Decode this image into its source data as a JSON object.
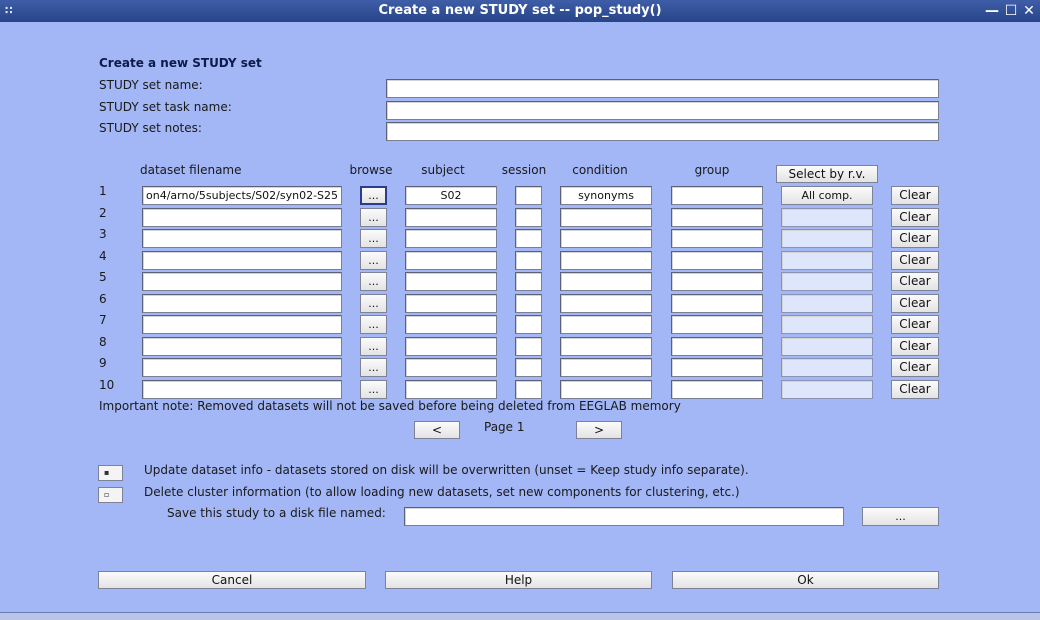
{
  "window": {
    "title": "Create a new STUDY set -- pop_study()",
    "minimize": "—",
    "maximize": "☐",
    "close": "✕"
  },
  "form": {
    "heading": "Create a new STUDY set",
    "name_label": "STUDY set name:",
    "task_label": "STUDY set task name:",
    "notes_label": "STUDY set notes:",
    "name_value": "",
    "task_value": "",
    "notes_value": ""
  },
  "table": {
    "headers": {
      "filename": "dataset filename",
      "browse": "browse",
      "subject": "subject",
      "session": "session",
      "condition": "condition",
      "group": "group"
    },
    "select_rv_label": "Select by r.v.",
    "browse_label": "...",
    "clear_label": "Clear",
    "rows": [
      {
        "num": "1",
        "filename": "on4/arno/5subjects/S02/syn02-S25",
        "subject": "S02",
        "session": "",
        "condition": "synonyms",
        "group": "",
        "comp": "All comp."
      },
      {
        "num": "2",
        "filename": "",
        "subject": "",
        "session": "",
        "condition": "",
        "group": "",
        "comp": ""
      },
      {
        "num": "3",
        "filename": "",
        "subject": "",
        "session": "",
        "condition": "",
        "group": "",
        "comp": ""
      },
      {
        "num": "4",
        "filename": "",
        "subject": "",
        "session": "",
        "condition": "",
        "group": "",
        "comp": ""
      },
      {
        "num": "5",
        "filename": "",
        "subject": "",
        "session": "",
        "condition": "",
        "group": "",
        "comp": ""
      },
      {
        "num": "6",
        "filename": "",
        "subject": "",
        "session": "",
        "condition": "",
        "group": "",
        "comp": ""
      },
      {
        "num": "7",
        "filename": "",
        "subject": "",
        "session": "",
        "condition": "",
        "group": "",
        "comp": ""
      },
      {
        "num": "8",
        "filename": "",
        "subject": "",
        "session": "",
        "condition": "",
        "group": "",
        "comp": ""
      },
      {
        "num": "9",
        "filename": "",
        "subject": "",
        "session": "",
        "condition": "",
        "group": "",
        "comp": ""
      },
      {
        "num": "10",
        "filename": "",
        "subject": "",
        "session": "",
        "condition": "",
        "group": "",
        "comp": ""
      }
    ]
  },
  "note": "Important note: Removed datasets will not be saved before being deleted from EEGLAB memory",
  "pager": {
    "prev": "<",
    "label": "Page 1",
    "next": ">"
  },
  "options": {
    "update": {
      "checked": true,
      "mark": "▪",
      "label": "Update dataset info - datasets stored on disk will be overwritten (unset = Keep study info separate)."
    },
    "delete_cluster": {
      "checked": false,
      "mark": "▫",
      "label": "Delete cluster information (to allow loading new datasets, set new components for clustering, etc.)"
    },
    "save_label": "Save this study to a disk file named:",
    "save_value": "",
    "save_browse": "..."
  },
  "actions": {
    "cancel": "Cancel",
    "help": "Help",
    "ok": "Ok"
  }
}
